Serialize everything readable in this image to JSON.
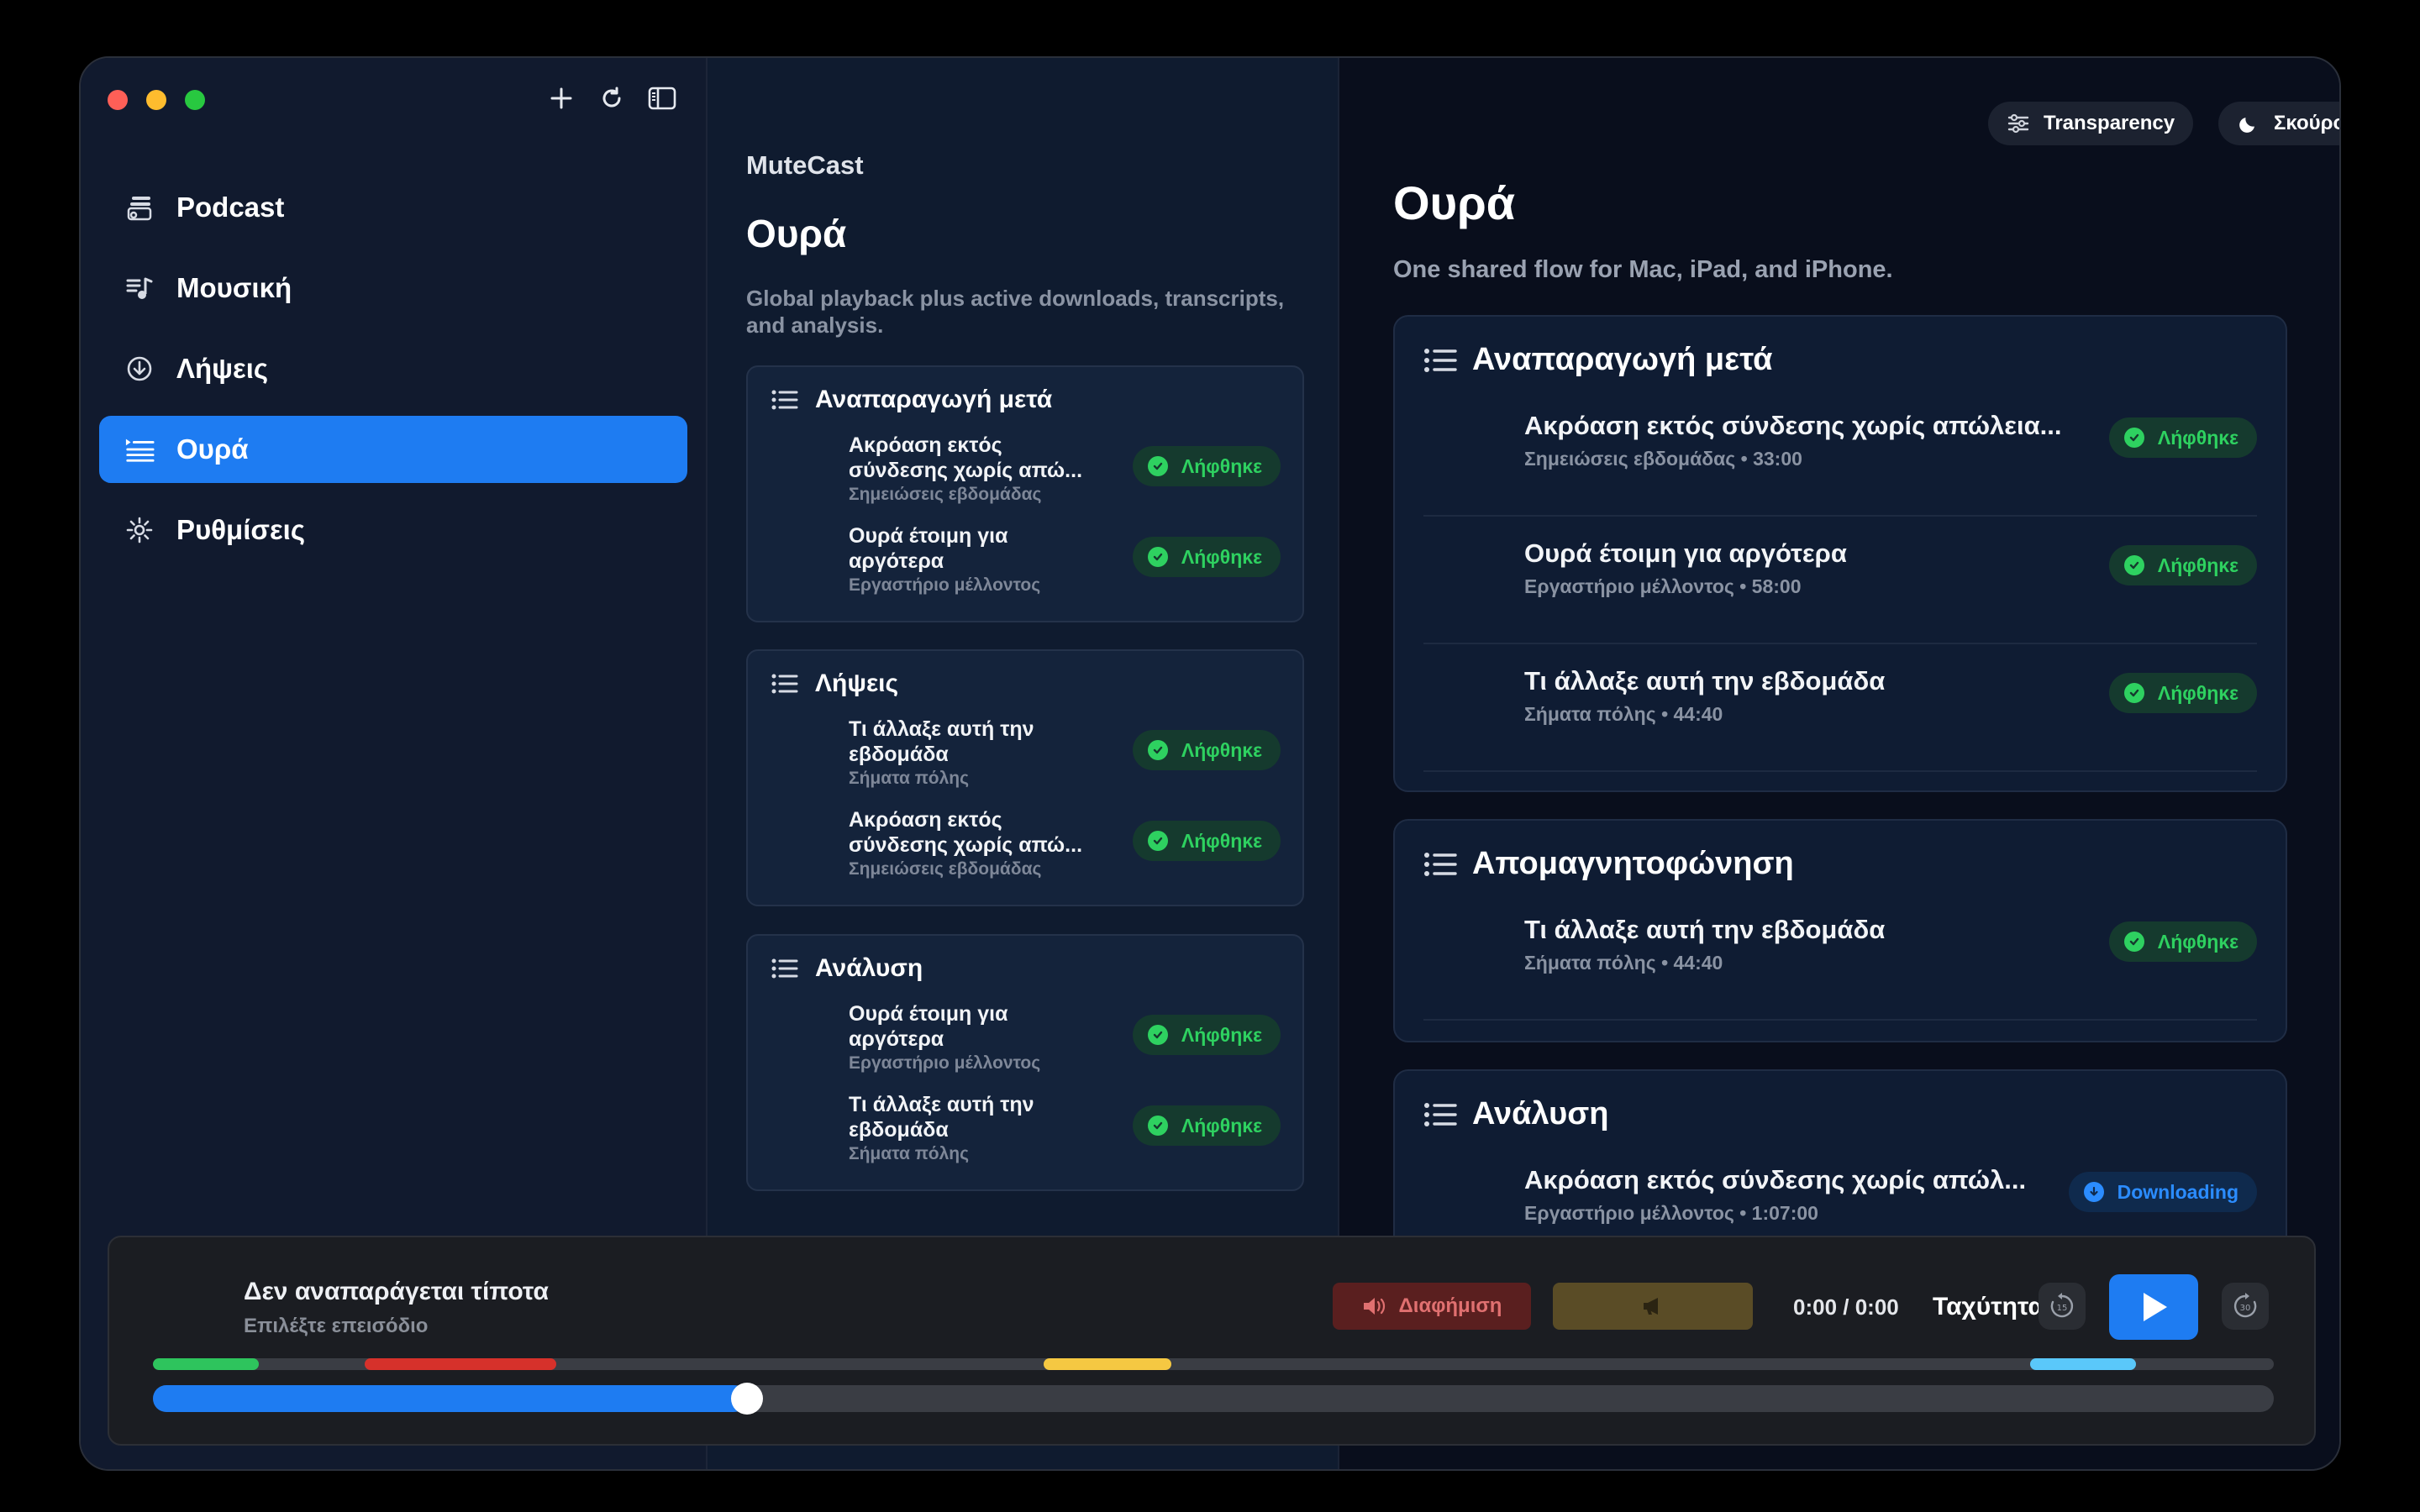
{
  "sidebar": {
    "items": [
      {
        "label": "Podcast",
        "icon": "podcast-icon"
      },
      {
        "label": "Μουσική",
        "icon": "music-icon"
      },
      {
        "label": "Λήψεις",
        "icon": "download-icon"
      },
      {
        "label": "Ουρά",
        "icon": "queue-icon",
        "active": true
      },
      {
        "label": "Ρυθμίσεις",
        "icon": "gear-icon"
      }
    ]
  },
  "middle": {
    "app_name": "MuteCast",
    "title": "Ουρά",
    "subtitle": "Global playback plus active downloads, transcripts, and analysis.",
    "cards": [
      {
        "header": "Αναπαραγωγή μετά",
        "rows": [
          {
            "title": "Ακρόαση εκτός σύνδεσης χωρίς απώ...",
            "meta": "Σημειώσεις εβδομάδας",
            "status": "Λήφθηκε"
          },
          {
            "title": "Ουρά έτοιμη για αργότερα",
            "meta": "Εργαστήριο μέλλοντος",
            "status": "Λήφθηκε"
          }
        ]
      },
      {
        "header": "Λήψεις",
        "rows": [
          {
            "title": "Τι άλλαξε αυτή την εβδομάδα",
            "meta": "Σήματα πόλης",
            "status": "Λήφθηκε"
          },
          {
            "title": "Ακρόαση εκτός σύνδεσης χωρίς απώ...",
            "meta": "Σημειώσεις εβδομάδας",
            "status": "Λήφθηκε"
          }
        ]
      },
      {
        "header": "Ανάλυση",
        "rows": [
          {
            "title": "Ουρά έτοιμη για αργότερα",
            "meta": "Εργαστήριο μέλλοντος",
            "status": "Λήφθηκε"
          },
          {
            "title": "Τι άλλαξε αυτή την εβδομάδα",
            "meta": "Σήματα πόλης",
            "status": "Λήφθηκε"
          }
        ]
      }
    ]
  },
  "right": {
    "transparency_label": "Transparency",
    "theme_label": "Σκούρο",
    "title": "Ουρά",
    "subtitle": "One shared flow for Mac, iPad, and iPhone.",
    "cards": [
      {
        "header": "Αναπαραγωγή μετά",
        "rows": [
          {
            "title": "Ακρόαση εκτός σύνδεσης χωρίς απώλεια...",
            "meta": "Σημειώσεις εβδομάδας • 33:00",
            "status": "Λήφθηκε"
          },
          {
            "title": "Ουρά έτοιμη για αργότερα",
            "meta": "Εργαστήριο μέλλοντος • 58:00",
            "status": "Λήφθηκε"
          },
          {
            "title": "Τι άλλαξε αυτή την εβδομάδα",
            "meta": "Σήματα πόλης • 44:40",
            "status": "Λήφθηκε"
          }
        ]
      },
      {
        "header": "Απομαγνητοφώνηση",
        "rows": [
          {
            "title": "Τι άλλαξε αυτή την εβδομάδα",
            "meta": "Σήματα πόλης • 44:40",
            "status": "Λήφθηκε"
          }
        ]
      },
      {
        "header": "Ανάλυση",
        "rows": [
          {
            "title": "Ακρόαση εκτός σύνδεσης χωρίς απώλ...",
            "meta": "Εργαστήριο μέλλοντος • 1:07:00",
            "status": "Downloading"
          }
        ]
      }
    ]
  },
  "player": {
    "title": "Δεν αναπαράγεται τίποτα",
    "subtitle": "Επιλέξτε επεισόδιο",
    "ad_label": "Διαφήμιση",
    "time": "0:00 / 0:00",
    "speed_label": "Ταχύτητα",
    "rewind_seconds": "15",
    "forward_seconds": "30",
    "progress_fraction": 0.28,
    "segments": [
      {
        "start": 0.0,
        "end": 0.05,
        "color": "#2ec45d"
      },
      {
        "start": 0.1,
        "end": 0.19,
        "color": "#d6312b"
      },
      {
        "start": 0.42,
        "end": 0.48,
        "color": "#f5c842"
      },
      {
        "start": 0.885,
        "end": 0.935,
        "color": "#5ac8fa"
      }
    ]
  },
  "colors": {
    "accent": "#1e7cf2",
    "success": "#2ed160",
    "downloading": "#2b8cff"
  }
}
